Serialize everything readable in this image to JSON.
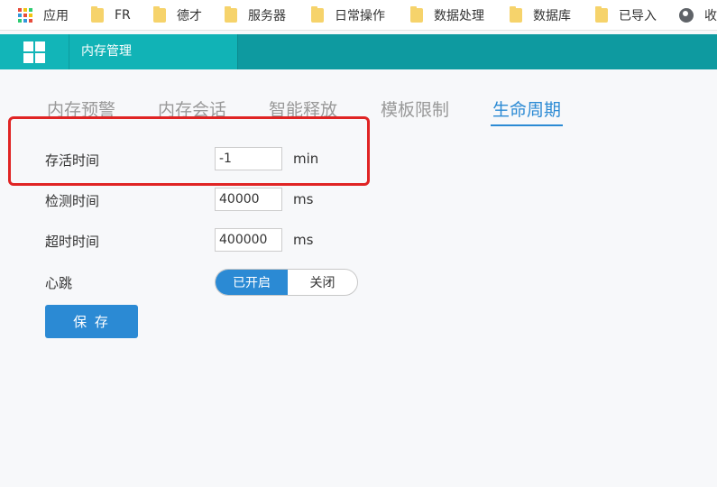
{
  "bookmarks": {
    "items": [
      {
        "label": "应用",
        "icon": "apps-icon"
      },
      {
        "label": "FR",
        "icon": "folder-icon"
      },
      {
        "label": "德才",
        "icon": "folder-icon"
      },
      {
        "label": "服务器",
        "icon": "folder-icon"
      },
      {
        "label": "日常操作",
        "icon": "folder-icon"
      },
      {
        "label": "数据处理",
        "icon": "folder-icon"
      },
      {
        "label": "数据库",
        "icon": "folder-icon"
      },
      {
        "label": "已导入",
        "icon": "folder-icon"
      },
      {
        "label": "收",
        "icon": "globe-icon"
      }
    ]
  },
  "header": {
    "active_tab": "内存管理",
    "colors": {
      "bar": "#0e9aa0",
      "tab": "#11b3b6"
    }
  },
  "tabs": [
    {
      "label": "内存预警",
      "active": false
    },
    {
      "label": "内存会话",
      "active": false
    },
    {
      "label": "智能释放",
      "active": false
    },
    {
      "label": "模板限制",
      "active": false
    },
    {
      "label": "生命周期",
      "active": true
    }
  ],
  "form": {
    "alive_time": {
      "label": "存活时间",
      "value": "-1",
      "unit": "min"
    },
    "check_time": {
      "label": "检测时间",
      "value": "40000",
      "unit": "ms"
    },
    "timeout_time": {
      "label": "超时时间",
      "value": "400000",
      "unit": "ms"
    },
    "heartbeat": {
      "label": "心跳",
      "on_label": "已开启",
      "off_label": "关闭",
      "state": "on"
    },
    "save_label": "保 存"
  },
  "colors": {
    "accent": "#2b8ad4",
    "highlight": "#e02424"
  }
}
